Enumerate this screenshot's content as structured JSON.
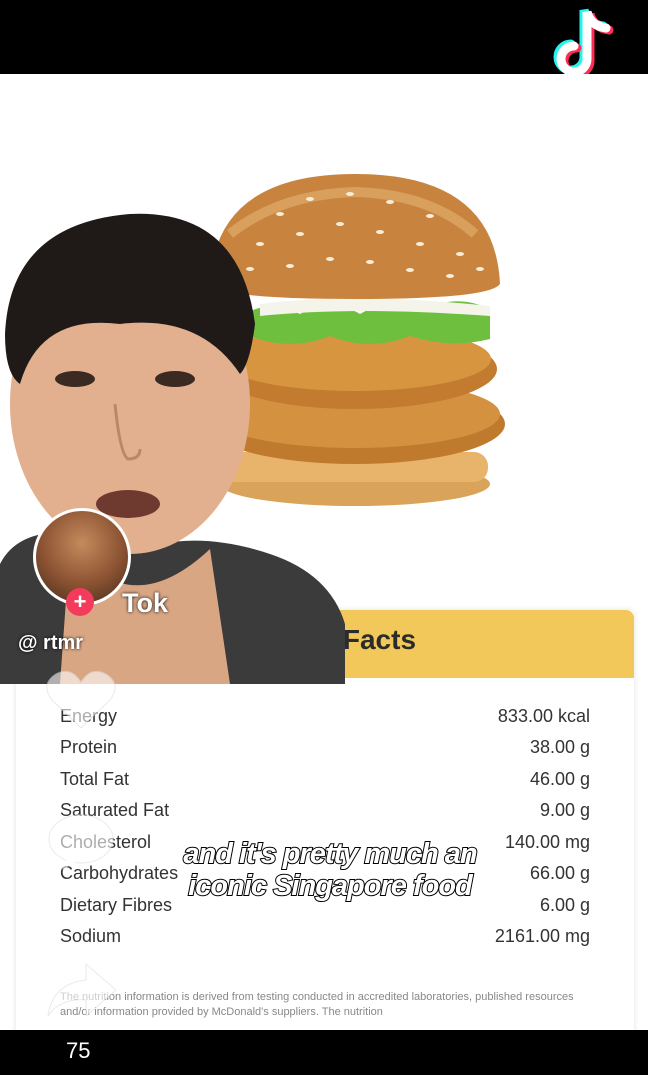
{
  "app": {
    "name": "TikTok",
    "brand_text": "Tok",
    "username": "@ rtmr"
  },
  "nutrition": {
    "title": "n Facts",
    "rows": [
      {
        "label": "Energy",
        "value": "833.00 kcal"
      },
      {
        "label": "Protein",
        "value": "38.00 g"
      },
      {
        "label": "Total Fat",
        "value": "46.00 g"
      },
      {
        "label": "Saturated Fat",
        "value": "9.00 g"
      },
      {
        "label": "Cholesterol",
        "value": "140.00 mg"
      },
      {
        "label": "Carbohydrates",
        "value": "66.00 g"
      },
      {
        "label": "Dietary Fibres",
        "value": "6.00 g"
      },
      {
        "label": "Sodium",
        "value": "2161.00 mg"
      }
    ],
    "disclaimer": "The nutrition information is derived from testing conducted in accredited laboratories, published resources and/or information provided by McDonald's suppliers. The nutrition"
  },
  "captions": {
    "line1": "and it's pretty much an",
    "line2": "iconic Singapore food"
  },
  "follow_label": "+",
  "counter": "75",
  "colors": {
    "header_yellow": "#f3c85a",
    "follow_red": "#f43b5c",
    "tiktok_cyan": "#25f4ee",
    "tiktok_red": "#fe2c55"
  },
  "icons": [
    "tiktok-logo-icon",
    "heart-icon",
    "comment-icon",
    "share-icon"
  ]
}
